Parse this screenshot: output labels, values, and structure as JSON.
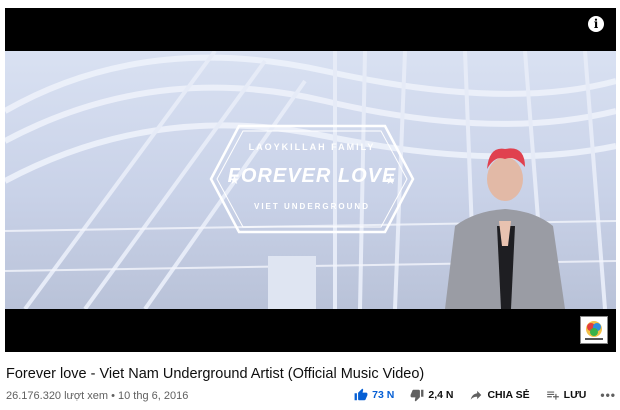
{
  "player": {
    "info_icon": "info-icon",
    "overlay": {
      "family_text": "LAOYKILLAH FAMILY",
      "title_text": "FOREVER LOVE",
      "sub_text": "VIET UNDERGROUND"
    }
  },
  "video": {
    "title": "Forever love - Viet Nam Underground Artist (Official Music Video)",
    "meta": "26.176.320 lượt xem • 10 thg 6, 2016"
  },
  "actions": {
    "like_count": "73 N",
    "dislike_count": "2,4 N",
    "share_label": "CHIA SẺ",
    "save_label": "LƯU",
    "more_icon": "more-horizontal-icon"
  },
  "colors": {
    "like_accent": "#065fd4",
    "text_primary": "#0f0f0f",
    "text_secondary": "#606060"
  }
}
